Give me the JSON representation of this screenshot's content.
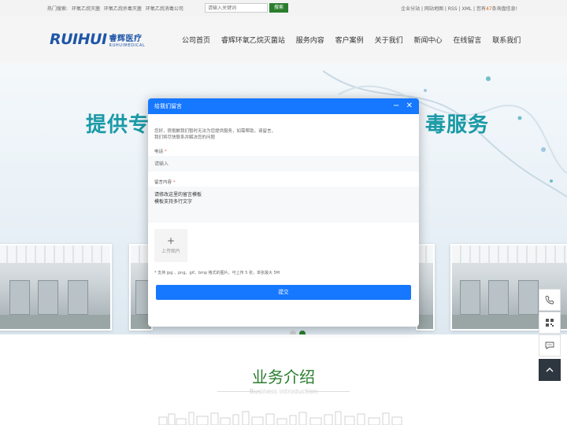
{
  "topbar": {
    "hot_label": "热门搜索:",
    "hot_terms": [
      "环氧乙烷灭菌",
      "环氧乙烷杀毒灭菌",
      "环氧乙烷消毒公司"
    ],
    "search_placeholder": "请输入关键词",
    "search_button": "搜索",
    "links": [
      "企业分站",
      "网站地图",
      "RSS",
      "XML"
    ],
    "notice_prefix": "您有",
    "notice_count": "47",
    "notice_suffix": "条询盘信息!"
  },
  "logo": {
    "mark": "RUIHUI",
    "cn": "睿辉医疗",
    "en": "RUHUIMEDICAL"
  },
  "nav": [
    "公司首页",
    "睿辉环氧乙烷灭菌站",
    "服务内容",
    "客户案例",
    "关于我们",
    "新闻中心",
    "在线留言",
    "联系我们"
  ],
  "banner": {
    "slogan_left": "提供专",
    "slogan_right": "毒服务"
  },
  "business": {
    "title": "业务介绍",
    "subtitle": "Business introduction"
  },
  "modal": {
    "title": "给我们留言",
    "minimize": "−",
    "close": "✕",
    "intro_line1": "您好，很抱歉我们暂时无法为您提供服务，如需帮助，请留言，",
    "intro_line2": "我们将尽快联系并解决您的问题",
    "phone_label": "电话",
    "phone_placeholder": "请输入",
    "message_label": "留言内容",
    "message_line1": "请修改这里的留言模板",
    "message_line2": "模板支持多行文字",
    "upload_plus": "+",
    "upload_label": "上传图片",
    "hint": "* 支持 jpg 、png、gif、bmp 格式的图片，可上传 5 张，单张最大 5M",
    "submit": "提交"
  },
  "colors": {
    "brand_green": "#2a7d2e",
    "modal_blue": "#1677ff",
    "slogan": "#1a9aa6",
    "logo_blue": "#1f56a8"
  },
  "side_tools": [
    "phone-icon",
    "qrcode-icon",
    "chat-icon",
    "back-to-top-icon"
  ]
}
